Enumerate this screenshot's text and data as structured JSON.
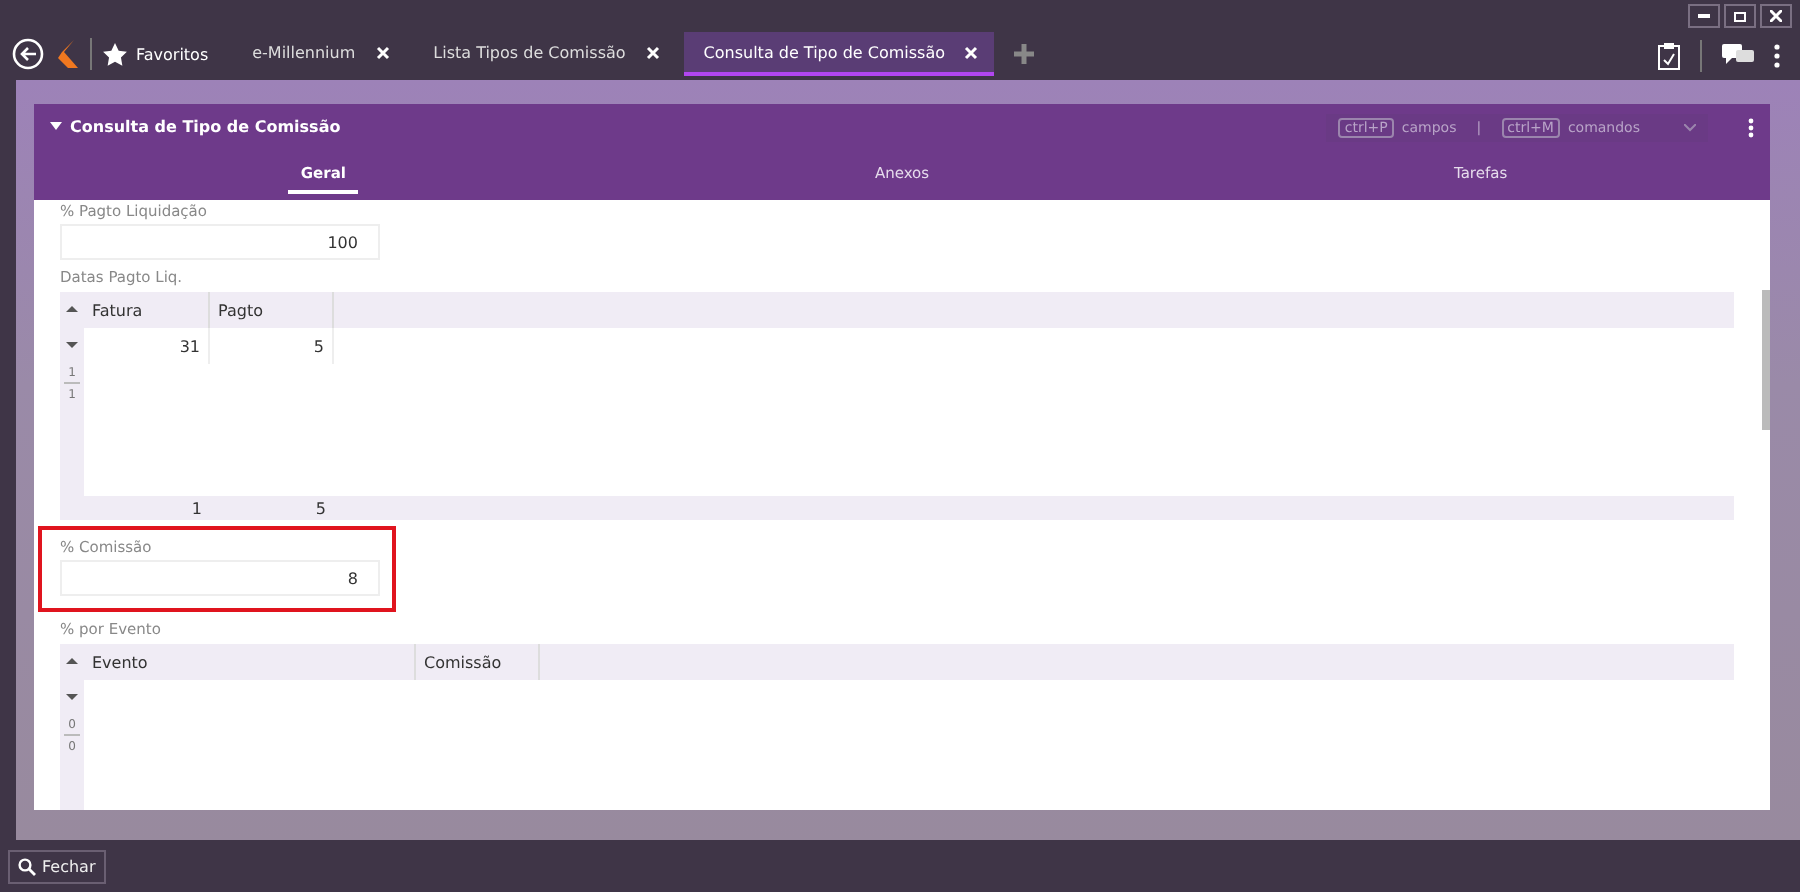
{
  "toolbar": {
    "favorites": "Favoritos"
  },
  "tabs": [
    {
      "label": "e-Millennium",
      "selected": false
    },
    {
      "label": "Lista Tipos de Comissão",
      "selected": false
    },
    {
      "label": "Consulta de Tipo de Comissão",
      "selected": true
    }
  ],
  "panel": {
    "title": "Consulta de Tipo de Comissão",
    "shortcuts": [
      {
        "key": "ctrl+P",
        "label": "campos"
      },
      {
        "key": "ctrl+M",
        "label": "comandos"
      }
    ],
    "separator": "|",
    "tabs": [
      {
        "label": "Geral",
        "selected": true
      },
      {
        "label": "Anexos",
        "selected": false
      },
      {
        "label": "Tarefas",
        "selected": false
      }
    ]
  },
  "form": [
    {
      "kind": "field",
      "label": "% Pagto Liquidação",
      "value": "100",
      "highlighted": false
    },
    {
      "kind": "grid",
      "label": "Datas Pagto Liq.",
      "columns": [
        "Fatura",
        "Pagto"
      ],
      "rows": [
        [
          "31",
          "5"
        ]
      ],
      "totals": [
        "1",
        "5"
      ],
      "counter": [
        "1",
        "1"
      ]
    },
    {
      "kind": "field",
      "label": "% Comissão",
      "value": "8",
      "highlighted": true
    },
    {
      "kind": "grid",
      "label": "% por Evento",
      "columns": [
        "Evento",
        "Comissão"
      ],
      "counter": [
        "0",
        "0"
      ]
    }
  ],
  "footer": {
    "button": "Fechar"
  }
}
